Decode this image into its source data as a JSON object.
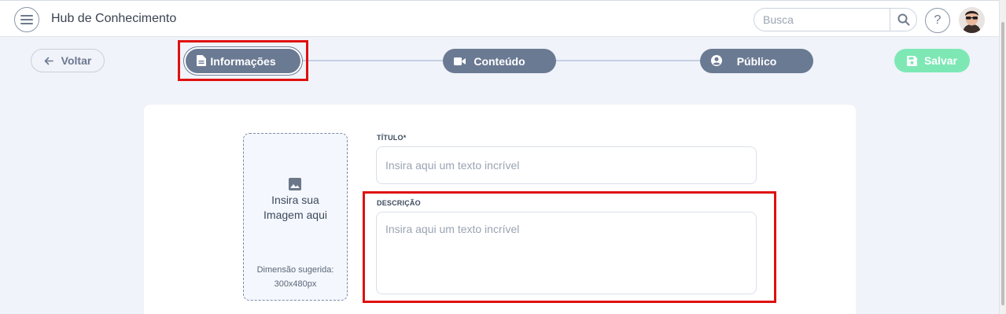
{
  "header": {
    "app_title": "Hub de Conhecimento",
    "search_placeholder": "Busca",
    "help_label": "?"
  },
  "toolbar": {
    "back_label": "Voltar",
    "save_label": "Salvar"
  },
  "steps": [
    {
      "label": "Informações",
      "icon": "document-icon",
      "active": true
    },
    {
      "label": "Conteúdo",
      "icon": "video-camera-icon",
      "active": false
    },
    {
      "label": "Público",
      "icon": "user-circle-icon",
      "active": false
    }
  ],
  "form": {
    "image": {
      "title_line1": "Insira sua",
      "title_line2": "Imagem aqui",
      "hint_line1": "Dimensão sugerida:",
      "hint_line2": "300x480px"
    },
    "title_label": "TÍTULO*",
    "title_placeholder": "Insira aqui um texto incrível",
    "description_label": "DESCRIÇÃO",
    "description_placeholder": "Insira aqui um texto incrível"
  },
  "colors": {
    "step_bg": "#6b7a93",
    "save_bg": "#7ee8b5",
    "highlight": "#e01010",
    "page_bg": "#f0f3f9"
  }
}
